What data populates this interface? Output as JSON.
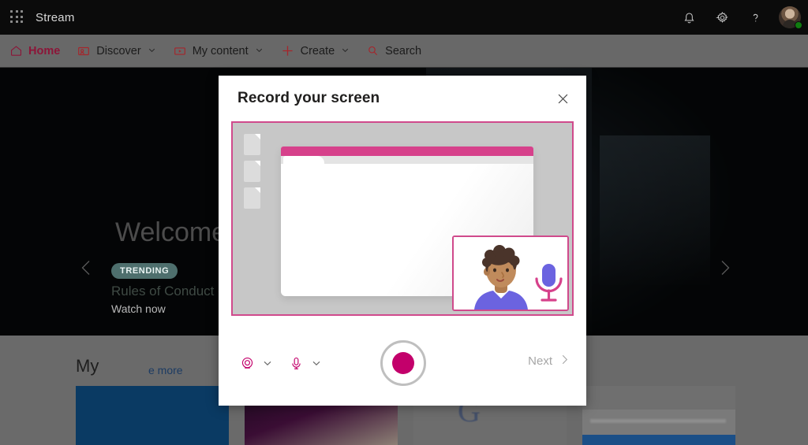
{
  "suite": {
    "app_name": "Stream",
    "waffle_icon": "app-launcher-icon",
    "icons": [
      {
        "name": "notifications-bell-icon",
        "label": "Notifications"
      },
      {
        "name": "settings-gear-icon",
        "label": "Settings"
      },
      {
        "name": "help-question-icon",
        "label": "Help"
      }
    ],
    "avatar": {
      "name": "user-avatar",
      "presence": "available",
      "presence_color": "#107c10"
    }
  },
  "nav": {
    "items": [
      {
        "label": "Home",
        "icon": "home-icon",
        "active": true,
        "has_chevron": false
      },
      {
        "label": "Discover",
        "icon": "discover-icon",
        "active": false,
        "has_chevron": true
      },
      {
        "label": "My content",
        "icon": "video-icon",
        "active": false,
        "has_chevron": true
      },
      {
        "label": "Create",
        "icon": "plus-icon",
        "active": false,
        "has_chevron": true
      },
      {
        "label": "Search",
        "icon": "search-icon",
        "active": false,
        "has_chevron": false
      }
    ]
  },
  "hero": {
    "title": "Welcome back",
    "badge": "TRENDING",
    "subtitle": "Rules of Conduct - T",
    "watch_link": "Watch now",
    "prev_icon": "chevron-left-icon",
    "next_icon": "chevron-right-icon",
    "pause_icon": "pause-icon"
  },
  "lower": {
    "section_title": "My",
    "see_more": "e more",
    "cards": [
      {
        "name": "video-card-1"
      },
      {
        "name": "video-card-2"
      },
      {
        "name": "video-card-3"
      },
      {
        "name": "video-card-4"
      }
    ]
  },
  "modal": {
    "title": "Record your screen",
    "close_icon": "close-icon",
    "illustration": {
      "name": "screen-recording-illustration",
      "accent_color": "#d04a8c",
      "window_bar_color": "#d6418b",
      "camera_preview": "camera-preview-thumbnail",
      "microphone_icon": "microphone-icon",
      "mic_body_color": "#6b63e0",
      "mic_stand_color": "#d6418b",
      "person": {
        "hair_color": "#4a342a",
        "skin_color": "#c08b5c",
        "shirt_color": "#6b63e0"
      }
    },
    "controls": {
      "camera_button": {
        "label": "Camera",
        "icon": "camera-icon"
      },
      "camera_dropdown": {
        "icon": "chevron-down-icon"
      },
      "microphone_button": {
        "label": "Microphone",
        "icon": "microphone-icon"
      },
      "microphone_dropdown": {
        "icon": "chevron-down-icon"
      },
      "record_button": {
        "label": "Record",
        "icon": "record-dot-icon",
        "color": "#c3006b"
      },
      "next_button": {
        "label": "Next",
        "icon": "chevron-right-icon",
        "enabled": false
      }
    }
  }
}
